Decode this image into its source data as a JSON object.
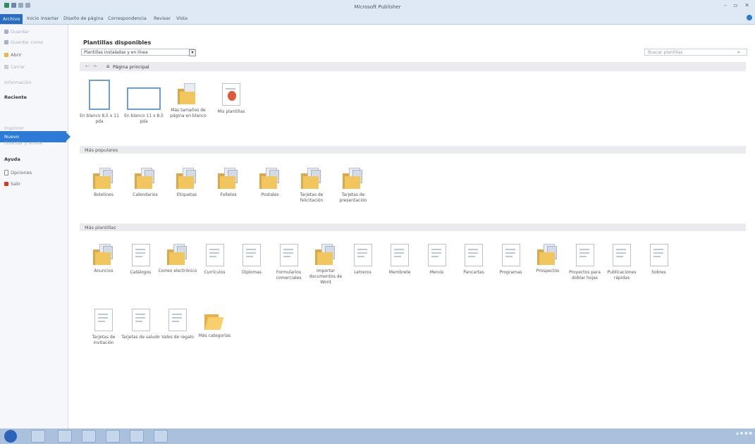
{
  "window": {
    "title": "Microsoft Publisher"
  },
  "ribbon": {
    "tabs": [
      "Archivo",
      "Inicio",
      "Insertar",
      "Diseño de página",
      "Correspondencia",
      "Revisar",
      "Vista"
    ]
  },
  "sidebar": {
    "items": [
      {
        "label": "Guardar",
        "state": "dim"
      },
      {
        "label": "Guardar como",
        "state": "dim"
      },
      {
        "label": "Abrir",
        "state": "normal"
      },
      {
        "label": "Cerrar",
        "state": "dim"
      },
      {
        "label": "Información",
        "state": "dim"
      },
      {
        "label": "Reciente",
        "state": "strong"
      },
      {
        "label": "Nuevo",
        "state": "active"
      },
      {
        "label": "Imprimir",
        "state": "dim"
      },
      {
        "label": "Guardar y enviar",
        "state": "dim"
      },
      {
        "label": "Ayuda",
        "state": "strong"
      },
      {
        "label": "Opciones",
        "state": "normal"
      },
      {
        "label": "Salir",
        "state": "normal"
      }
    ]
  },
  "main": {
    "heading": "Plantillas disponibles",
    "dropdown_value": "Plantillas instaladas y en línea",
    "search_placeholder": "Buscar plantillas",
    "home_label": "Página principal",
    "blank_tiles": [
      "En blanco 8,5 x 11 pda",
      "En blanco 11 x 8,5 pda",
      "Más tamaños de página en blanco",
      "Mis plantillas"
    ],
    "section_popular": "Más populares",
    "popular": [
      "Boletines",
      "Calendarios",
      "Etiquetas",
      "Folletos",
      "Postales",
      "Tarjetas de felicitación",
      "Tarjetas de presentación"
    ],
    "section_more": "Más plantillas",
    "more_row1": [
      "Anuncios",
      "Catálogos",
      "Correo electrónico",
      "Currículos",
      "Diplomas",
      "Formularios comerciales",
      "Importar documentos de Word",
      "Letreros",
      "Membrete",
      "Menús",
      "Pancartas",
      "Programas",
      "Prospectos",
      "Proyectos para doblar hojas",
      "Publicaciones rápidas",
      "Sobres"
    ],
    "more_row2": [
      "Tarjetas de invitación",
      "Tarjetas de saludo",
      "Vales de regalo",
      "Más categorías"
    ]
  },
  "colors": {
    "accent": "#2c7bd6",
    "folder": "#f2c65f",
    "taskbar": "#a9c1dc"
  }
}
